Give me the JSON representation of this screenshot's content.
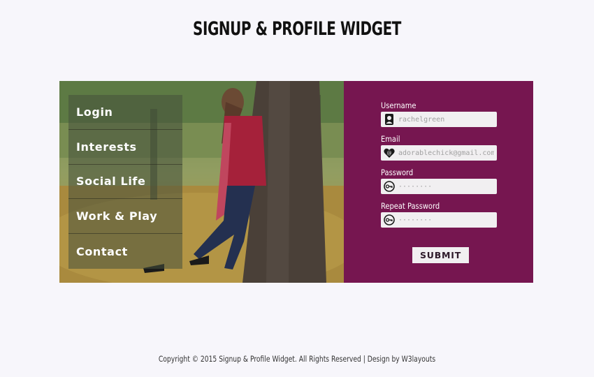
{
  "header": {
    "title": "SIGNUP & PROFILE WIDGET"
  },
  "menu": {
    "items": [
      {
        "label": "Login"
      },
      {
        "label": "Interests"
      },
      {
        "label": "Social Life"
      },
      {
        "label": "Work & Play"
      },
      {
        "label": "Contact"
      }
    ]
  },
  "form": {
    "username": {
      "label": "Username",
      "placeholder": "rachelgreen",
      "icon": "user-icon"
    },
    "email": {
      "label": "Email",
      "placeholder": "adorablechick@gmail.com",
      "icon": "at-heart-icon"
    },
    "password": {
      "label": "Password",
      "placeholder": "········",
      "icon": "key-icon"
    },
    "repeat_password": {
      "label": "Repeat Password",
      "placeholder": "········",
      "icon": "key-icon"
    },
    "submit_label": "SUBMIT"
  },
  "footer": {
    "text": "Copyright © 2015 Signup & Profile Widget. All Rights Reserved | Design by W3layouts"
  },
  "colors": {
    "page_background": "#f7f6fb",
    "form_panel": "#761650",
    "field_background": "#f1eff1"
  }
}
